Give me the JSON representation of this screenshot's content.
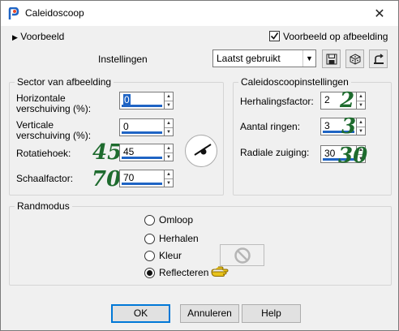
{
  "window": {
    "title": "Caleidoscoop",
    "close_glyph": "✕"
  },
  "top": {
    "preview_toggle": "Voorbeeld",
    "preview_checkbox_label": "Voorbeeld op afbeelding",
    "settings_label": "Instellingen",
    "preset_value": "Laatst gebruikt"
  },
  "sector": {
    "title": "Sector van afbeelding",
    "horizontal_label_1": "Horizontale",
    "horizontal_label_2": "verschuiving (%):",
    "horizontal_value": "0",
    "vertical_label_1": "Verticale",
    "vertical_label_2": "verschuiving (%):",
    "vertical_value": "0",
    "rotation_label": "Rotatiehoek:",
    "rotation_value": "45",
    "rotation_annotation": "45",
    "scale_label": "Schaalfactor:",
    "scale_value": "70",
    "scale_annotation": "70"
  },
  "kaleido": {
    "title": "Caleidoscoopinstellingen",
    "repeat_label": "Herhalingsfactor:",
    "repeat_value": "2",
    "repeat_annotation": "2",
    "rings_label": "Aantal ringen:",
    "rings_value": "3",
    "rings_annotation": "3",
    "radial_label": "Radiale zuiging:",
    "radial_value": "30",
    "radial_annotation": "30"
  },
  "edge_mode": {
    "title": "Randmodus",
    "options": [
      "Omloop",
      "Herhalen",
      "Kleur",
      "Reflecteren"
    ],
    "selected": "Reflecteren"
  },
  "buttons": {
    "ok": "OK",
    "cancel": "Annuleren",
    "help": "Help"
  },
  "colors": {
    "accent": "#1f64c4",
    "annotation": "#1e6b2e",
    "pointer": "#e8c21a"
  }
}
